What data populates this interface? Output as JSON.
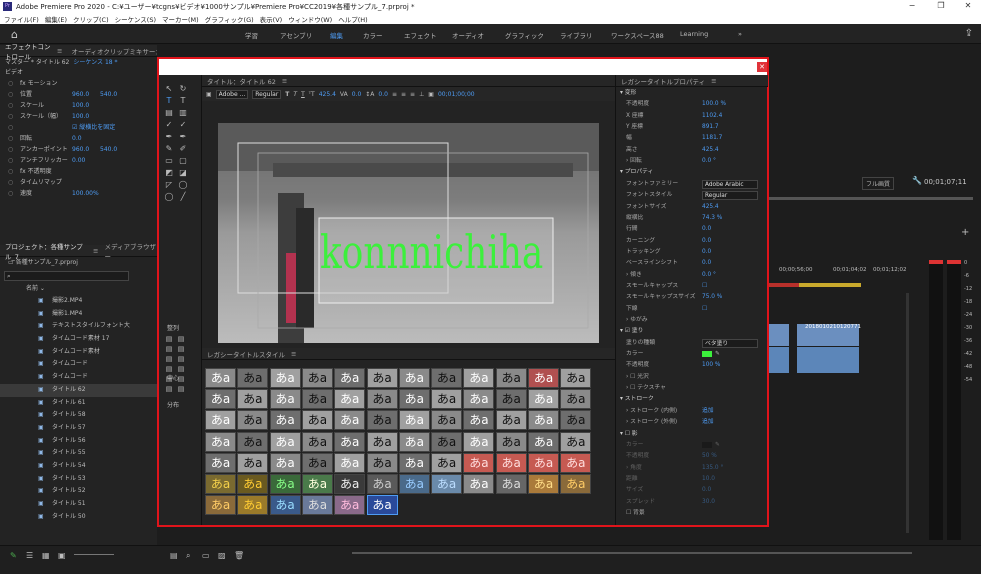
{
  "window": {
    "title": "Adobe Premiere Pro 2020 - C:¥ユーザー¥tcgns¥ビデオ¥1000サンプル¥Premiere Pro¥CC2019¥各種サンプル_7.prproj *",
    "app_icon": "Pr",
    "minimize": "−",
    "maximize": "❐",
    "close": "✕"
  },
  "menu": [
    "ファイル(F)",
    "編集(E)",
    "クリップ(C)",
    "シーケンス(S)",
    "マーカー(M)",
    "グラフィック(G)",
    "表示(V)",
    "ウィンドウ(W)",
    "ヘルプ(H)"
  ],
  "workspaces": {
    "items": [
      "学習",
      "アセンブリ",
      "編集",
      "カラー",
      "エフェクト",
      "オーディオ",
      "グラフィック",
      "ライブラリ",
      "ワークスペース88",
      "Learning"
    ],
    "active": "編集",
    "more": "»"
  },
  "effect_controls": {
    "tab": "エフェクトコントロール",
    "tab2": "オーディオクリップミキサー：シーケンス 18",
    "tab3": "プログラム：シーケンス 18",
    "master": "マスター * タイトル 62",
    "seq": "シーケンス 18 *",
    "section": "ビデオ",
    "rows": [
      {
        "label": "fx モーション",
        "val": "",
        "val2": ""
      },
      {
        "label": "位置",
        "val": "960.0",
        "val2": "540.0"
      },
      {
        "label": "スケール",
        "val": "100.0",
        "val2": ""
      },
      {
        "label": "スケール（幅）",
        "val": "100.0",
        "val2": ""
      },
      {
        "label": "",
        "val": "☑ 縦横比を固定",
        "val2": ""
      },
      {
        "label": "回転",
        "val": "0.0",
        "val2": ""
      },
      {
        "label": "アンカーポイント",
        "val": "960.0",
        "val2": "540.0"
      },
      {
        "label": "アンチフリッカー",
        "val": "0.00",
        "val2": ""
      },
      {
        "label": "fx 不透明度",
        "val": "",
        "val2": ""
      },
      {
        "label": "タイムリマップ",
        "val": "",
        "val2": ""
      },
      {
        "label": "速度",
        "val": "100.00%",
        "val2": ""
      }
    ]
  },
  "project": {
    "tab": "プロジェクト：各種サンプル_7",
    "tab2": "メディアブラウザー",
    "file": "各種サンプル_7.prproj",
    "name_col": "名前",
    "items": [
      "撮影2.MP4",
      "撮影1.MP4",
      "テキストスタイルフォント大",
      "タイムコード素材 17",
      "タイムコード素材",
      "タイムコード",
      "タイムコード",
      "タイトル 62",
      "タイトル 61",
      "タイトル 58",
      "タイトル 57",
      "タイトル 56",
      "タイトル 55",
      "タイトル 54",
      "タイトル 53",
      "タイトル 52",
      "タイトル 51",
      "タイトル 50"
    ]
  },
  "titler": {
    "panel": "タイトル：タイトル 62",
    "font": "Adobe ...",
    "style": "Regular",
    "size": "425.4",
    "kerning": "0.0",
    "leading": "0.0",
    "timecode": "00;01;00;00",
    "text": "konnnichiha",
    "align_label": "整列",
    "center_label": "中心",
    "distribute_label": "分布"
  },
  "styles": {
    "panel": "レガシータイトルスタイル",
    "swatches": [
      [
        "あa",
        "あa",
        "あa",
        "あa",
        "あa",
        "あa",
        "あa",
        "あa",
        "あa",
        "あa",
        "あa",
        "あa"
      ],
      [
        "あa",
        "あa",
        "あa",
        "あa",
        "あa",
        "あa",
        "あa",
        "あa",
        "あa",
        "あa",
        "あa",
        "あa"
      ],
      [
        "あa",
        "あa",
        "あa",
        "あa",
        "あa",
        "あa",
        "あa",
        "あa",
        "あa",
        "あa",
        "あa",
        "あa"
      ],
      [
        "あa",
        "あa",
        "あa",
        "あa",
        "あa",
        "あa",
        "あa",
        "あa",
        "あa",
        "あa",
        "あa",
        "あa"
      ],
      [
        "あa",
        "あa",
        "あa",
        "あa",
        "あa",
        "あa",
        "あa",
        "あa",
        "あa",
        "あa",
        "あa",
        "あa"
      ],
      [
        "あa",
        "あa",
        "あa",
        "あa",
        "あa",
        "あa",
        "あa",
        "あa",
        "あa",
        "あa",
        "あa",
        "あa"
      ],
      [
        "あa",
        "あa",
        "あa",
        "あa",
        "あa",
        "あa"
      ]
    ]
  },
  "props": {
    "panel": "レガシータイトルプロパティ",
    "rows": [
      {
        "l": "▾ 変形",
        "v": ""
      },
      {
        "l": "不透明度",
        "v": "100.0 %"
      },
      {
        "l": "X 座標",
        "v": "1102.4"
      },
      {
        "l": "Y 座標",
        "v": "891.7"
      },
      {
        "l": "幅",
        "v": "1181.7"
      },
      {
        "l": "高さ",
        "v": "425.4"
      },
      {
        "l": "› 回転",
        "v": "0.0 °"
      },
      {
        "l": "▾ プロパティ",
        "v": ""
      },
      {
        "l": "フォントファミリー",
        "v": "Adobe Arabic"
      },
      {
        "l": "フォントスタイル",
        "v": "Regular"
      },
      {
        "l": "フォントサイズ",
        "v": "425.4"
      },
      {
        "l": "縦横比",
        "v": "74.3 %"
      },
      {
        "l": "行間",
        "v": "0.0"
      },
      {
        "l": "カーニング",
        "v": "0.0"
      },
      {
        "l": "トラッキング",
        "v": "0.0"
      },
      {
        "l": "ベースラインシフト",
        "v": "0.0"
      },
      {
        "l": "› 傾き",
        "v": "0.0 °"
      },
      {
        "l": "スモールキャップス",
        "v": "☐"
      },
      {
        "l": "スモールキャップスサイズ",
        "v": "75.0 %"
      },
      {
        "l": "下線",
        "v": "☐"
      },
      {
        "l": "› ゆがみ",
        "v": ""
      },
      {
        "l": "▾ ☑ 塗り",
        "v": ""
      },
      {
        "l": "塗りの種類",
        "v": "ベタ塗り"
      },
      {
        "l": "カラー",
        "v": ""
      },
      {
        "l": "不透明度",
        "v": "100 %"
      },
      {
        "l": "› ☐ 光沢",
        "v": ""
      },
      {
        "l": "› ☐ テクスチャ",
        "v": ""
      },
      {
        "l": "▾ ストローク",
        "v": ""
      },
      {
        "l": "› ストローク (内側)",
        "v": "追加"
      },
      {
        "l": "› ストローク (外側)",
        "v": "追加"
      },
      {
        "l": "▾ ☐ 影",
        "v": ""
      },
      {
        "l": "カラー",
        "v": ""
      },
      {
        "l": "不透明度",
        "v": "50 %"
      },
      {
        "l": "› 角度",
        "v": "135.0 °"
      },
      {
        "l": "距離",
        "v": "10.0"
      },
      {
        "l": "サイズ",
        "v": "0.0"
      },
      {
        "l": "スプレッド",
        "v": "30.0"
      },
      {
        "l": "☐ 背景",
        "v": ""
      }
    ]
  },
  "program": {
    "fit": "フル画質",
    "timecode": "00;01;07;11",
    "tick1": "00;00;56;00",
    "tick2": "00;01;04;02",
    "tick3": "00;01;12;02",
    "clip": "2018010210120771",
    "meter": [
      "0",
      "-6",
      "-12",
      "-18",
      "-24",
      "-30",
      "-36",
      "-42",
      "-48",
      "-54"
    ],
    "solo": "S"
  },
  "colors": {
    "accent": "#4e9cf4",
    "highlight": "#e0141b",
    "title_text": "#3cf03c"
  }
}
